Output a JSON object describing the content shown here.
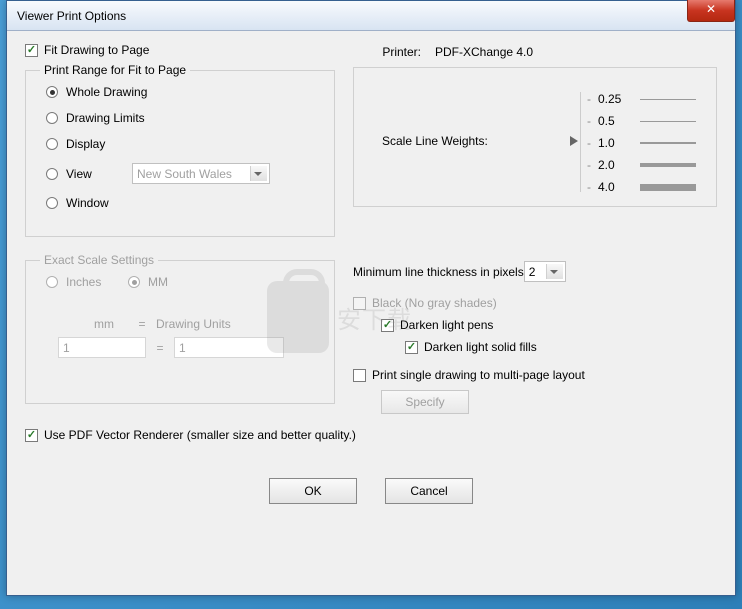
{
  "window": {
    "title": "Viewer Print Options"
  },
  "fitDrawing": {
    "label": "Fit Drawing to Page",
    "checked": true
  },
  "printer": {
    "label": "Printer:",
    "value": "PDF-XChange 4.0"
  },
  "printRange": {
    "legend": "Print Range for Fit to Page",
    "options": {
      "whole": "Whole Drawing",
      "limits": "Drawing Limits",
      "display": "Display",
      "view": "View",
      "window": "Window"
    },
    "selected": "whole",
    "viewCombo": "New South Wales"
  },
  "scaleWeights": {
    "label": "Scale Line Weights:",
    "values": [
      "0.25",
      "0.5",
      "1.0",
      "2.0",
      "4.0"
    ],
    "selected": "1.0"
  },
  "exactScale": {
    "legend": "Exact Scale Settings",
    "units": {
      "inches": "Inches",
      "mm": "MM",
      "selected": "mm"
    },
    "mmLabel": "mm",
    "eq": "=",
    "duLabel": "Drawing Units",
    "mmValue": "1",
    "duValue": "1"
  },
  "minLine": {
    "label": "Minimum line thickness in pixels",
    "value": "2"
  },
  "blackNoGray": {
    "label": "Black (No gray shades)",
    "checked": false
  },
  "darkenPens": {
    "label": "Darken light pens",
    "checked": true
  },
  "darkenFills": {
    "label": "Darken light solid fills",
    "checked": true
  },
  "multiPage": {
    "label": "Print single drawing to multi-page layout",
    "checked": false
  },
  "specify": {
    "label": "Specify"
  },
  "pdfRenderer": {
    "label": "Use PDF Vector Renderer (smaller size and better quality.)",
    "checked": true
  },
  "buttons": {
    "ok": "OK",
    "cancel": "Cancel"
  },
  "watermark": "安下载"
}
